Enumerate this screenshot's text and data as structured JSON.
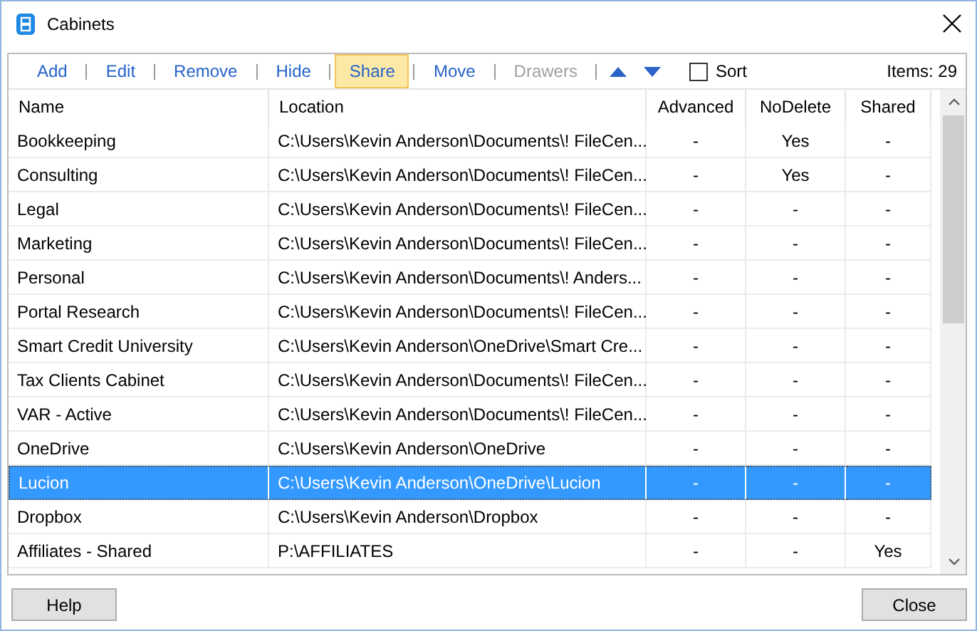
{
  "window": {
    "title": "Cabinets"
  },
  "toolbar": {
    "buttons": [
      {
        "label": "Add",
        "selected": false,
        "disabled": false
      },
      {
        "label": "Edit",
        "selected": false,
        "disabled": false
      },
      {
        "label": "Remove",
        "selected": false,
        "disabled": false
      },
      {
        "label": "Hide",
        "selected": false,
        "disabled": false
      },
      {
        "label": "Share",
        "selected": true,
        "disabled": false
      },
      {
        "label": "Move",
        "selected": false,
        "disabled": false
      },
      {
        "label": "Drawers",
        "selected": false,
        "disabled": true
      }
    ],
    "sort": {
      "label": "Sort",
      "checked": false
    },
    "items_count": "Items: 29"
  },
  "table": {
    "columns": [
      "Name",
      "Location",
      "Advanced",
      "NoDelete",
      "Shared"
    ],
    "rows": [
      {
        "cells": [
          "Bookkeeping",
          "C:\\Users\\Kevin Anderson\\Documents\\! FileCen...",
          "-",
          "Yes",
          "-"
        ],
        "selected": false
      },
      {
        "cells": [
          "Consulting",
          "C:\\Users\\Kevin Anderson\\Documents\\! FileCen...",
          "-",
          "Yes",
          "-"
        ],
        "selected": false
      },
      {
        "cells": [
          "Legal",
          "C:\\Users\\Kevin Anderson\\Documents\\! FileCen...",
          "-",
          "-",
          "-"
        ],
        "selected": false
      },
      {
        "cells": [
          "Marketing",
          "C:\\Users\\Kevin Anderson\\Documents\\! FileCen...",
          "-",
          "-",
          "-"
        ],
        "selected": false
      },
      {
        "cells": [
          "Personal",
          "C:\\Users\\Kevin Anderson\\Documents\\! Anders...",
          "-",
          "-",
          "-"
        ],
        "selected": false
      },
      {
        "cells": [
          "Portal Research",
          "C:\\Users\\Kevin Anderson\\Documents\\! FileCen...",
          "-",
          "-",
          "-"
        ],
        "selected": false
      },
      {
        "cells": [
          "Smart Credit University",
          "C:\\Users\\Kevin Anderson\\OneDrive\\Smart Cre...",
          "-",
          "-",
          "-"
        ],
        "selected": false
      },
      {
        "cells": [
          "Tax Clients Cabinet",
          "C:\\Users\\Kevin Anderson\\Documents\\! FileCen...",
          "-",
          "-",
          "-"
        ],
        "selected": false
      },
      {
        "cells": [
          "VAR - Active",
          "C:\\Users\\Kevin Anderson\\Documents\\! FileCen...",
          "-",
          "-",
          "-"
        ],
        "selected": false
      },
      {
        "cells": [
          "OneDrive",
          "C:\\Users\\Kevin Anderson\\OneDrive",
          "-",
          "-",
          "-"
        ],
        "selected": false
      },
      {
        "cells": [
          "Lucion",
          "C:\\Users\\Kevin Anderson\\OneDrive\\Lucion",
          "-",
          "-",
          "-"
        ],
        "selected": true
      },
      {
        "cells": [
          "Dropbox",
          "C:\\Users\\Kevin Anderson\\Dropbox",
          "-",
          "-",
          "-"
        ],
        "selected": false
      },
      {
        "cells": [
          "Affiliates - Shared",
          "P:\\AFFILIATES",
          "-",
          "-",
          "Yes"
        ],
        "selected": false
      }
    ]
  },
  "footer": {
    "buttons": [
      "Help",
      "Close"
    ]
  }
}
